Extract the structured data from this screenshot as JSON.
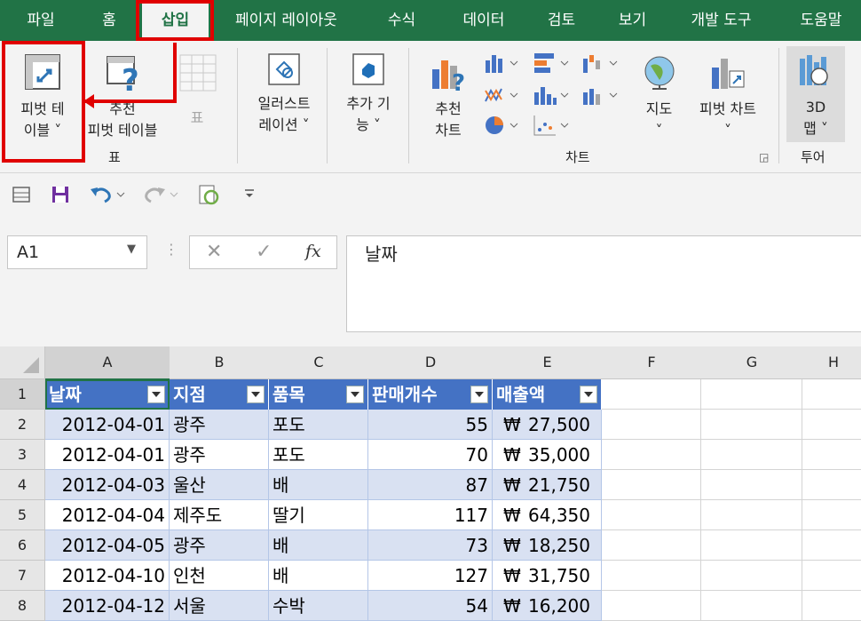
{
  "ribbon_tabs": [
    "파일",
    "홈",
    "삽입",
    "페이지 레이아웃",
    "수식",
    "데이터",
    "검토",
    "보기",
    "개발 도구",
    "도움말"
  ],
  "ribbon": {
    "pivot_table_line1": "피벗 테",
    "pivot_table_line2": "이블 ˅",
    "recommended_line1": "추천",
    "recommended_line2": "피벗 테이블",
    "table_label": "표",
    "group_table": "표",
    "illustrations_line1": "일러스트",
    "illustrations_line2": "레이션 ˅",
    "addins_line1": "추가 기",
    "addins_line2": "능 ˅",
    "rec_charts_line1": "추천",
    "rec_charts_line2": "차트",
    "maps_label": "지도",
    "maps_arrow": "˅",
    "pivot_chart_label": "피벗 차트",
    "pivot_chart_arrow": "˅",
    "map3d_line1": "3D",
    "map3d_line2": "맵 ˅",
    "group_charts": "차트",
    "group_tours": "투어"
  },
  "name_box": "A1",
  "formula_value": "날짜",
  "fx_label": "fx",
  "columns": [
    "A",
    "B",
    "C",
    "D",
    "E",
    "F",
    "G",
    "H"
  ],
  "row_numbers": [
    "1",
    "2",
    "3",
    "4",
    "5",
    "6",
    "7",
    "8"
  ],
  "table": {
    "headers": [
      "날짜",
      "지점",
      "품목",
      "판매개수",
      "매출액"
    ],
    "rows": [
      [
        "2012-04-01",
        "광주",
        "포도",
        "55",
        "₩ 27,500"
      ],
      [
        "2012-04-01",
        "광주",
        "포도",
        "70",
        "₩ 35,000"
      ],
      [
        "2012-04-03",
        "울산",
        "배",
        "87",
        "₩ 21,750"
      ],
      [
        "2012-04-04",
        "제주도",
        "딸기",
        "117",
        "₩ 64,350"
      ],
      [
        "2012-04-05",
        "광주",
        "배",
        "73",
        "₩ 18,250"
      ],
      [
        "2012-04-10",
        "인천",
        "배",
        "127",
        "₩ 31,750"
      ],
      [
        "2012-04-12",
        "서울",
        "수박",
        "54",
        "₩ 16,200"
      ]
    ]
  },
  "colors": {
    "excel_green": "#217346",
    "table_header": "#4472c4",
    "band": "#d9e1f2",
    "highlight": "#e00000"
  }
}
